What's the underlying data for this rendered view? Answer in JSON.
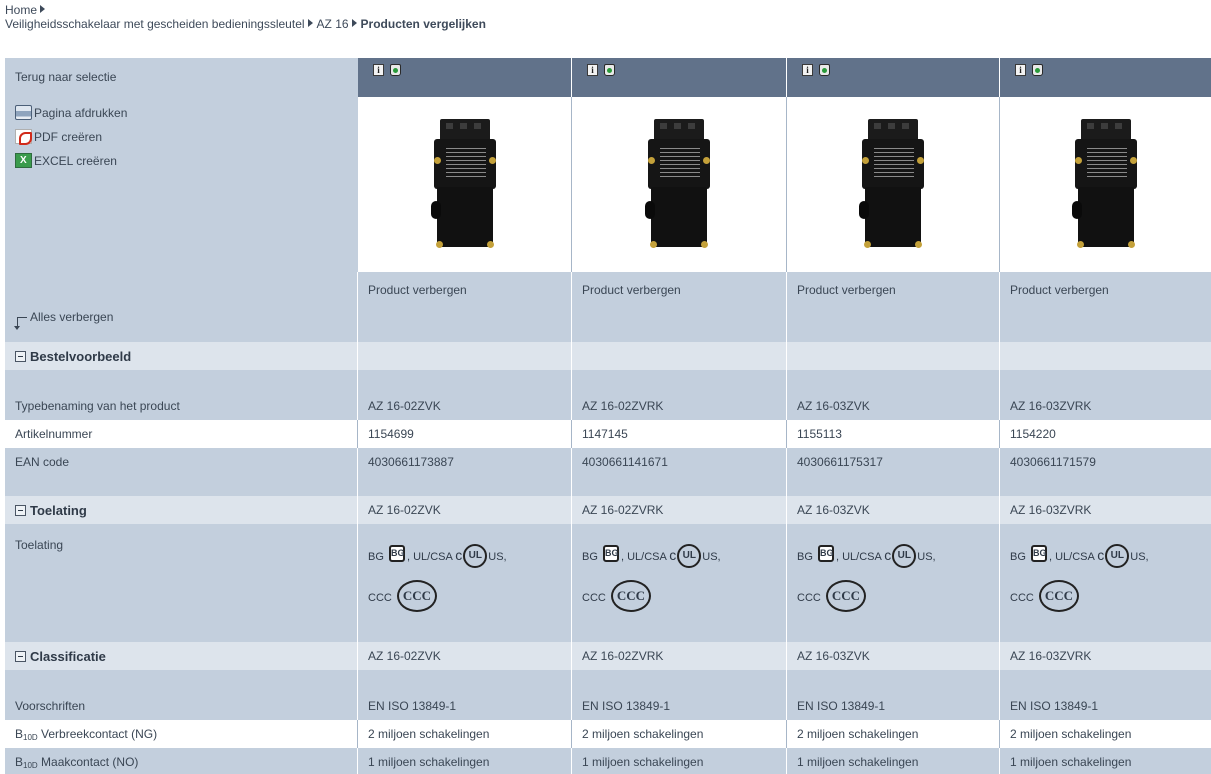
{
  "breadcrumb": {
    "home": "Home",
    "category": "Veiligheidsschakelaar met gescheiden bedieningssleutel",
    "series": "AZ 16",
    "current": "Producten vergelijken"
  },
  "sidebar": {
    "back_link": "Terug naar selectie",
    "print": "Pagina afdrukken",
    "pdf": "PDF creëren",
    "excel": "EXCEL creëren",
    "hide_all": "Alles verbergen"
  },
  "hide_product": "Product verbergen",
  "sections": {
    "order": "Bestelvoorbeeld",
    "approval": "Toelating",
    "classification": "Classificatie"
  },
  "labels": {
    "type": "Typebenaming van het product",
    "article": "Artikelnummer",
    "ean": "EAN code",
    "approval": "Toelating",
    "regulations": "Voorschriften",
    "b10_prefix": "B",
    "b10_sub": "10D",
    "b10_nc": " Verbreekcontact (NG)",
    "b10_no": " Maakcontact (NO)"
  },
  "approval_text": {
    "bg": "BG",
    "bg_mark": "BG",
    "ulcsa": ", UL/CSA",
    "c": "c",
    "ul": "UL",
    "us": "US,",
    "ccc": "CCC",
    "ccc_mark": "CCC"
  },
  "products": [
    {
      "type": "AZ 16-02ZVK",
      "article": "1154699",
      "ean": "4030661173887",
      "regulation": "EN ISO 13849-1",
      "b10_nc": "2 miljoen schakelingen",
      "b10_no": "1 miljoen schakelingen"
    },
    {
      "type": "AZ 16-02ZVRK",
      "article": "1147145",
      "ean": "4030661141671",
      "regulation": "EN ISO 13849-1",
      "b10_nc": "2 miljoen schakelingen",
      "b10_no": "1 miljoen schakelingen"
    },
    {
      "type": "AZ 16-03ZVK",
      "article": "1155113",
      "ean": "4030661175317",
      "regulation": "EN ISO 13849-1",
      "b10_nc": "2 miljoen schakelingen",
      "b10_no": "1 miljoen schakelingen"
    },
    {
      "type": "AZ 16-03ZVRK",
      "article": "1154220",
      "ean": "4030661171579",
      "regulation": "EN ISO 13849-1",
      "b10_nc": "2 miljoen schakelingen",
      "b10_no": "1 miljoen schakelingen"
    }
  ],
  "icons": {
    "info": "info-icon",
    "delete": "trash-icon",
    "print": "printer-icon",
    "pdf": "pdf-icon",
    "excel": "excel-icon"
  },
  "colors": {
    "header_bar": "#61728a",
    "row_blue": "#c3cfdd",
    "row_white": "#ffffff",
    "text": "#3a4654"
  }
}
